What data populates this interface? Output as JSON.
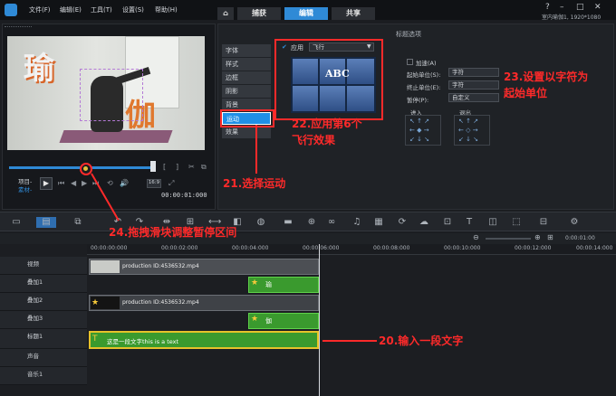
{
  "menu": {
    "file": "文件(F)",
    "edit": "编辑(E)",
    "tools": "工具(T)",
    "settings": "设置(S)",
    "help": "帮助(H)"
  },
  "tabs": {
    "capture": "捕获",
    "edit": "编辑",
    "share": "共享"
  },
  "project_info": "室内瑜伽1, 1920*1080",
  "preview": {
    "overlay_text_1": "瑜",
    "overlay_text_2": "伽",
    "project_label": "项目-",
    "clip_label": "素材-",
    "zoom_value": "16:9",
    "timecode": "00:00:01:000"
  },
  "options": {
    "header": "标题选项",
    "side_tabs": [
      "字体",
      "样式",
      "边框",
      "阴影",
      "背景",
      "运动",
      "效果"
    ],
    "apply_label": "应用",
    "effect_select": "飞行",
    "thumb_text": "ABC",
    "accelerate_label": "加速(A)",
    "start_unit_label": "起始单位(S):",
    "start_unit_value": "字符",
    "end_unit_label": "终止单位(E):",
    "end_unit_value": "字符",
    "pause_label": "暂停(P):",
    "pause_value": "自定义",
    "enter_label": "进入",
    "exit_label": "退出"
  },
  "annotations": {
    "a20": "20.输入一段文字",
    "a21": "21.选择运动",
    "a22_line1": "22.应用第6个",
    "a22_line2": "飞行效果",
    "a23_line1": "23.设置以字符为",
    "a23_line2": "起始单位",
    "a24": "24.拖拽滑块调整暂停区间"
  },
  "timeline": {
    "ruler": [
      "00:00:00:000",
      "00:00:02:000",
      "00:00:04:000",
      "00:00:06:000",
      "00:00:08:000",
      "00:00:10:000",
      "00:00:12:000",
      "00:00:14:000"
    ],
    "zoom_timecode": "0:00:01:00",
    "tracks": [
      "视频",
      "叠加1",
      "叠加2",
      "叠加3",
      "标题1",
      "声音",
      "音乐1"
    ],
    "clip_video": "production ID:4536532.mp4",
    "clip_overlay": "production ID:4536532.mp4",
    "clip_small_1": "瑜",
    "clip_small_2": "伽",
    "title_clip": "这是一段文字this is a text"
  },
  "colors": {
    "accent": "#2f8ad6",
    "annotation": "#ff2a2a",
    "clip_green": "#3a9a2e"
  }
}
